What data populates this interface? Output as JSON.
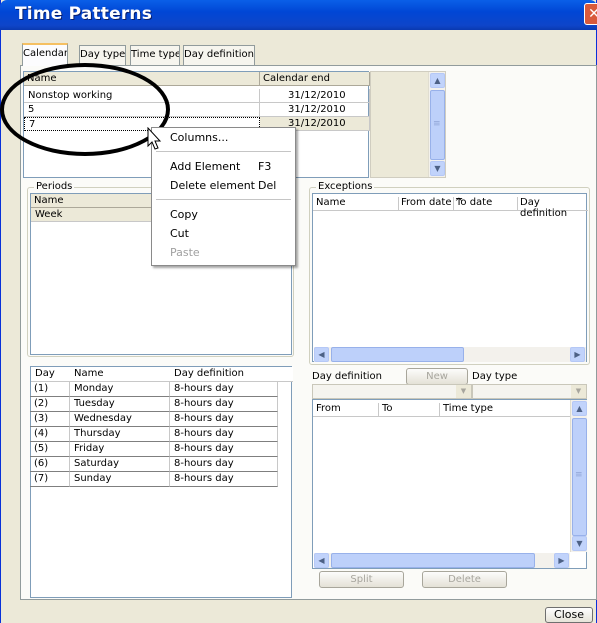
{
  "window": {
    "title": "Time Patterns",
    "close_glyph": "✕"
  },
  "tabs": [
    {
      "label": "Calendars",
      "active": true
    },
    {
      "label": "Day type"
    },
    {
      "label": "Time type"
    },
    {
      "label": "Day definitions"
    }
  ],
  "calendars": {
    "columns": [
      "Name",
      "Calendar end"
    ],
    "rows": [
      [
        "Nonstop working",
        "31/12/2010"
      ],
      [
        "5",
        "31/12/2010"
      ],
      [
        "7",
        "31/12/2010"
      ]
    ]
  },
  "periods": {
    "title": "Periods",
    "columns": [
      "Name"
    ],
    "rows": [
      "Week"
    ]
  },
  "days": {
    "columns": [
      "Day",
      "Name",
      "Day definition"
    ],
    "rows": [
      [
        "(1)",
        "Monday",
        "8-hours day"
      ],
      [
        "(2)",
        "Tuesday",
        "8-hours day"
      ],
      [
        "(3)",
        "Wednesday",
        "8-hours day"
      ],
      [
        "(4)",
        "Thursday",
        "8-hours day"
      ],
      [
        "(5)",
        "Friday",
        "8-hours day"
      ],
      [
        "(6)",
        "Saturday",
        "8-hours day"
      ],
      [
        "(7)",
        "Sunday",
        "8-hours day"
      ]
    ]
  },
  "exceptions": {
    "title": "Exceptions",
    "columns": [
      "Name",
      "From date ^",
      "To date",
      "Day definition"
    ]
  },
  "daydef": {
    "label": "Day definition",
    "new_label": "New",
    "daytype_label": "Day type",
    "columns": [
      "From",
      "To",
      "Time type"
    ]
  },
  "buttons": {
    "split": "Split",
    "delete": "Delete",
    "close": "Close"
  },
  "context_menu": {
    "columns": "Columns...",
    "add": "Add Element",
    "add_shortcut": "F3",
    "delete": "Delete element",
    "delete_shortcut": "Del",
    "copy": "Copy",
    "cut": "Cut",
    "paste": "Paste"
  },
  "icons": {
    "up": "▲",
    "down": "▼",
    "left": "◀",
    "right": "▶",
    "grip": "≡"
  }
}
